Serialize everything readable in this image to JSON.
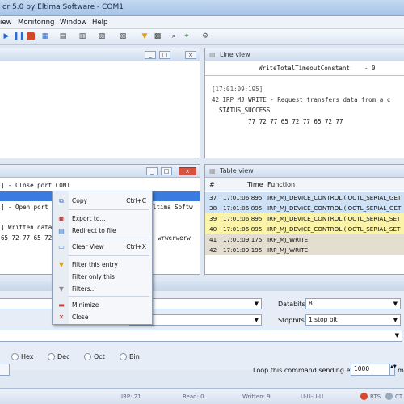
{
  "title": "or 5.0 by Eltima Software - COM1",
  "menu": [
    "iew",
    "Monitoring",
    "Window",
    "Help"
  ],
  "panes": {
    "top_left": {
      "controls": [
        "_",
        "□",
        "×"
      ]
    },
    "line_view": {
      "title": "Line view",
      "lines": [
        "WriteTotalTimeoutConstant    - 0",
        "[17:01:09:195]",
        "42 IRP_MJ_WRITE - Request transfers data from a c",
        "  STATUS_SUCCESS",
        "          77 72 77 65 72 77 65 72 77"
      ]
    },
    "bottom_left": {
      "lines": [
        "] - Close port COM1",
        "] - Open port",
        "] Written data",
        "65 72 77 65 72"
      ],
      "trailing": [
        "ltima Softw",
        "wrwerwerw"
      ],
      "controls": [
        "_",
        "□",
        "×"
      ]
    },
    "table_view": {
      "title": "Table view",
      "columns": [
        "#",
        "Time",
        "Function"
      ],
      "rows": [
        {
          "num": "37",
          "time": "17:01:06:895",
          "func": "IRP_MJ_DEVICE_CONTROL (IOCTL_SERIAL_GET",
          "color": "#cfe1f5"
        },
        {
          "num": "38",
          "time": "17:01:06:895",
          "func": "IRP_MJ_DEVICE_CONTROL (IOCTL_SERIAL_GET",
          "color": "#cfe1f5"
        },
        {
          "num": "39",
          "time": "17:01:06:895",
          "func": "IRP_MJ_DEVICE_CONTROL (IOCTL_SERIAL_SET",
          "color": "#fbf4a8"
        },
        {
          "num": "40",
          "time": "17:01:06:895",
          "func": "IRP_MJ_DEVICE_CONTROL (IOCTL_SERIAL_SET",
          "color": "#fbf4a8"
        },
        {
          "num": "41",
          "time": "17:01:09:175",
          "func": "IRP_MJ_WRITE",
          "color": "#e4ded0"
        },
        {
          "num": "42",
          "time": "17:01:09:195",
          "func": "IRP_MJ_WRITE",
          "color": "#e4ded0"
        }
      ]
    }
  },
  "context_menu": [
    {
      "label": "Copy",
      "shortcut": "Ctrl+C",
      "icon": "copy-icon",
      "glyph": "⧉",
      "color": "#3a6fc4"
    },
    {
      "label": "Export to...",
      "shortcut": "",
      "icon": "export-icon",
      "glyph": "▣",
      "color": "#c04040"
    },
    {
      "label": "Redirect to file",
      "shortcut": "",
      "icon": "redirect-icon",
      "glyph": "▤",
      "color": "#4a7fcf"
    },
    {
      "label": "Clear View",
      "shortcut": "Ctrl+X",
      "icon": "clear-icon",
      "glyph": "▭",
      "color": "#4a7fcf"
    },
    {
      "label": "Filter this entry",
      "shortcut": "",
      "icon": "filter-icon",
      "glyph": "▼",
      "color": "#d9a21a"
    },
    {
      "label": "Filter only this",
      "shortcut": "",
      "icon": "filter-only-icon",
      "glyph": "",
      "color": "#999"
    },
    {
      "label": "Filters...",
      "shortcut": "",
      "icon": "filters-icon",
      "glyph": "▼",
      "color": "#888"
    },
    {
      "label": "Minimize",
      "shortcut": "",
      "icon": "minimize-icon",
      "glyph": "▬",
      "color": "#c04040"
    },
    {
      "label": "Close",
      "shortcut": "",
      "icon": "close-icon",
      "glyph": "✕",
      "color": "#c8302a"
    }
  ],
  "settings": {
    "databits_label": "Databits:",
    "databits_value": "8",
    "stopbits_label": "Stopbits:",
    "stopbits_value": "1 stop bit",
    "formats": [
      "Hex",
      "Dec",
      "Oct",
      "Bin"
    ],
    "loop_label": "Loop this command sending every",
    "loop_value": "1000",
    "loop_unit": "m"
  },
  "status": [
    "IRP: 21",
    "Read: 0",
    "Written: 9",
    "U-U-U-U",
    "RTS",
    "CT"
  ]
}
